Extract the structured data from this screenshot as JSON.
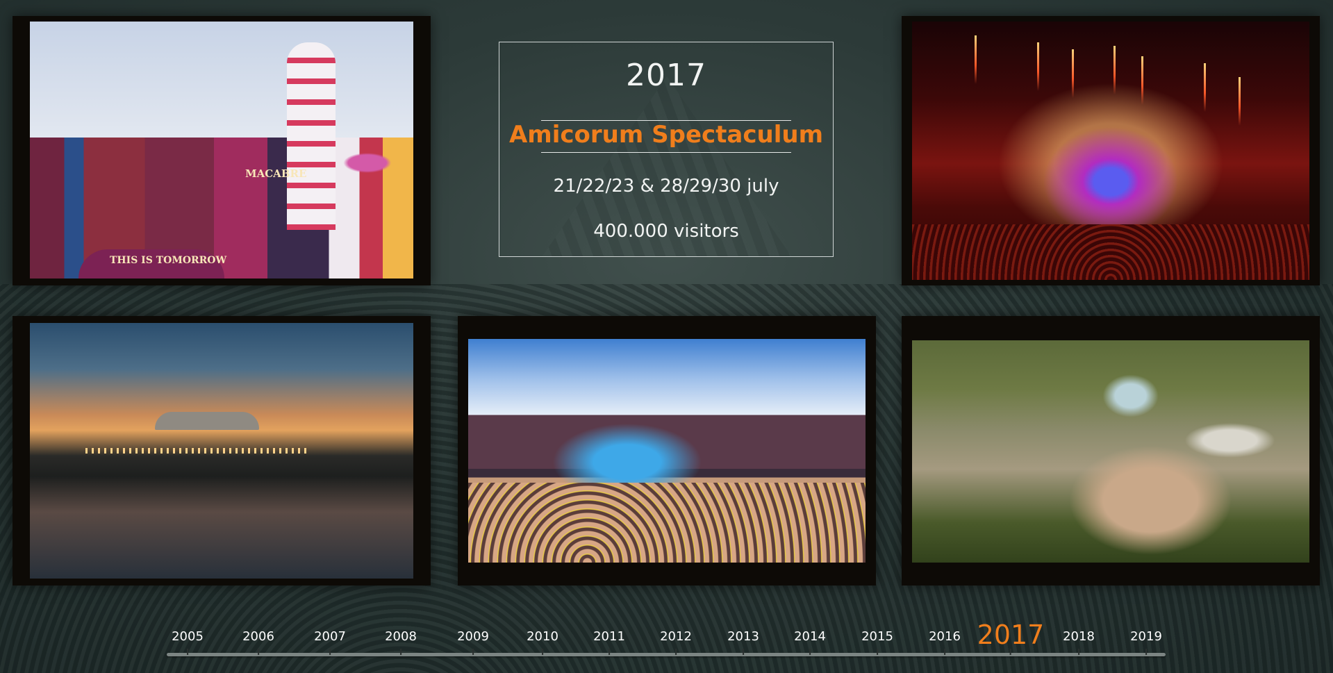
{
  "info": {
    "year": "2017",
    "edition": "Amicorum Spectaculum",
    "dates": "21/22/23 & 28/29/30 july",
    "visitors": "400.000 visitors"
  },
  "photos": [
    {
      "name": "circus-facade-photo"
    },
    {
      "name": "main-stage-night-photo"
    },
    {
      "name": "sunset-lake-photo"
    },
    {
      "name": "main-stage-day-photo"
    },
    {
      "name": "aerial-festival-photo"
    }
  ],
  "photo_texts": {
    "macabre": "MACABRE",
    "tomorrow": "THIS IS TOMORROW"
  },
  "timeline": {
    "years": [
      "2005",
      "2006",
      "2007",
      "2008",
      "2009",
      "2010",
      "2011",
      "2012",
      "2013",
      "2014",
      "2015",
      "2016",
      "2017",
      "2018",
      "2019"
    ],
    "active": "2017"
  },
  "colors": {
    "accent": "#f07e1c",
    "text": "#f2f4f3",
    "background": "#2c3a38"
  }
}
